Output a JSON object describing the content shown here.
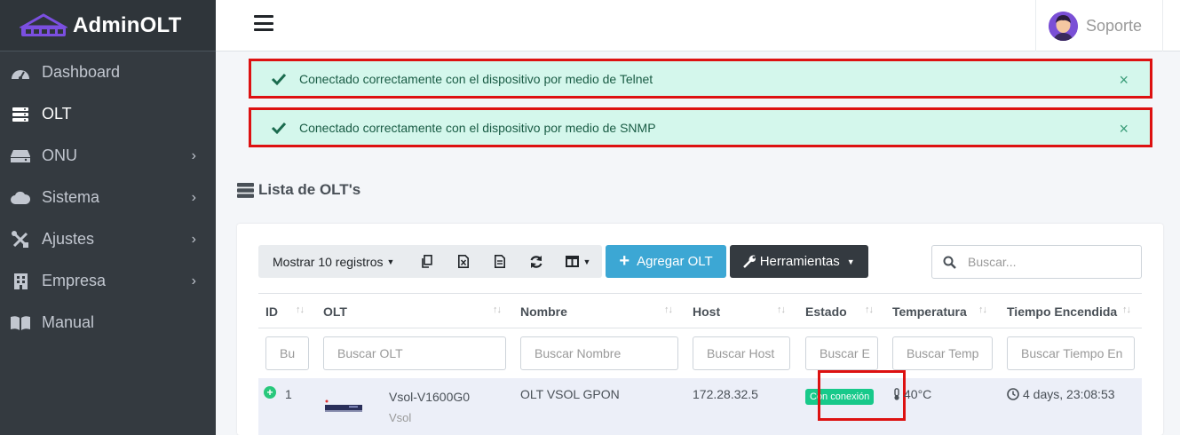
{
  "brand": {
    "name": "AdminOLT"
  },
  "sidebar": {
    "items": [
      {
        "label": "Dashboard",
        "icon": "tachometer-icon",
        "chevron": ""
      },
      {
        "label": "OLT",
        "icon": "server-icon",
        "chevron": ""
      },
      {
        "label": "ONU",
        "icon": "hdd-icon",
        "chevron": "›"
      },
      {
        "label": "Sistema",
        "icon": "cloud-icon",
        "chevron": "›"
      },
      {
        "label": "Ajustes",
        "icon": "tools-icon",
        "chevron": "›"
      },
      {
        "label": "Empresa",
        "icon": "building-icon",
        "chevron": "›"
      },
      {
        "label": "Manual",
        "icon": "book-icon",
        "chevron": ""
      }
    ]
  },
  "topbar": {
    "user": "Soporte"
  },
  "alerts": [
    {
      "text": "Conectado correctamente con el dispositivo por medio de Telnet",
      "close": "×"
    },
    {
      "text": "Conectado correctamente con el dispositivo por medio de SNMP",
      "close": "×"
    }
  ],
  "section": {
    "title": "Lista de OLT's"
  },
  "toolbar": {
    "show_records": "Mostrar 10 registros",
    "add_label": "Agregar OLT",
    "tools_label": "Herramientas",
    "search_placeholder": "Buscar..."
  },
  "table": {
    "columns": [
      "ID",
      "OLT",
      "Nombre",
      "Host",
      "Estado",
      "Temperatura",
      "Tiempo Encendida"
    ],
    "filters": [
      "Bu",
      "Buscar OLT",
      "Buscar Nombre",
      "Buscar Host",
      "Buscar E",
      "Buscar Temp",
      "Buscar Tiempo En"
    ],
    "rows": [
      {
        "id": "1",
        "olt_model": "Vsol-V1600G0",
        "olt_brand": "Vsol",
        "nombre": "OLT VSOL GPON",
        "host": "172.28.32.5",
        "estado": "Con conexión",
        "temperatura": "40°C",
        "tiempo": "4 days, 23:08:53"
      }
    ]
  },
  "colors": {
    "sidebar_bg": "#343a40",
    "alert_bg": "#d4f7ec",
    "add_button": "#3ca7d4",
    "badge_success": "#18c98a",
    "highlight_border": "#dd1111"
  }
}
